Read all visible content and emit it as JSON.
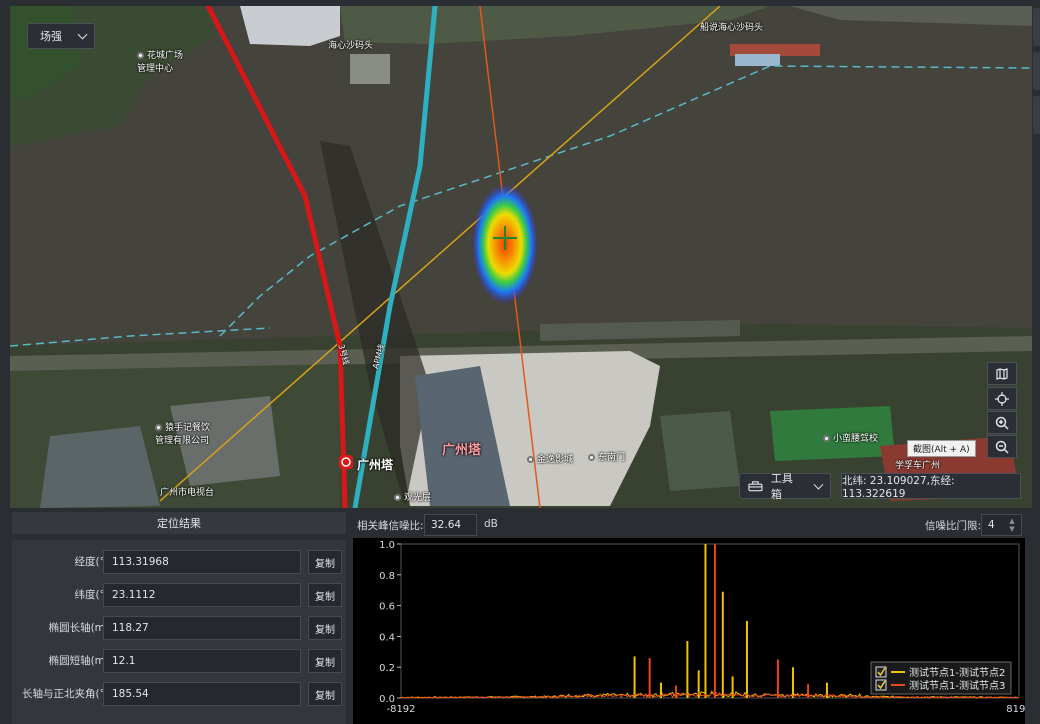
{
  "map": {
    "mode_label": "场强",
    "toolbox_label": "工具箱",
    "coordinates": "北纬: 23.109027,东经: 113.322619",
    "snapshot_tooltip": "截图(Alt + A)",
    "labels": [
      {
        "text": "花城广场\n管理中心",
        "kind": "poi"
      },
      {
        "text": "海心沙码头",
        "kind": "poi"
      },
      {
        "text": "船说海心沙码头",
        "kind": "poi"
      },
      {
        "text": "猿手记餐饮\n管理有限公司",
        "kind": "poi"
      },
      {
        "text": "广州市电视台",
        "kind": "poi"
      },
      {
        "text": "广州塔",
        "kind": "metro"
      },
      {
        "text": "广州塔",
        "kind": "landmark"
      },
      {
        "text": "金逸影城",
        "kind": "poi"
      },
      {
        "text": "东南门",
        "kind": "poi"
      },
      {
        "text": "观光层",
        "kind": "poi"
      },
      {
        "text": "小蛮腰驾校",
        "kind": "poi"
      },
      {
        "text": "学孚车广州",
        "kind": "poi"
      },
      {
        "text": "3号线",
        "kind": "line"
      },
      {
        "text": "APM线",
        "kind": "line"
      }
    ],
    "controls": [
      "map-layers-icon",
      "locate-icon",
      "zoom-in-icon",
      "zoom-out-icon"
    ]
  },
  "results": {
    "title": "定位结果",
    "copy_label": "复制",
    "rows": [
      {
        "label": "经度(°)",
        "value": "113.31968"
      },
      {
        "label": "纬度(°)",
        "value": "23.1112"
      },
      {
        "label": "椭圆长轴(m)",
        "value": "118.27"
      },
      {
        "label": "椭圆短轴(m)",
        "value": "12.1"
      },
      {
        "label": "长轴与正北夹角(°)",
        "value": "185.54"
      }
    ]
  },
  "spectrum": {
    "snr_label": "相关峰信噪比:",
    "snr_value": "32.64",
    "snr_unit": "dB",
    "threshold_label": "信噪比门限:",
    "threshold_value": "4"
  },
  "chart_data": {
    "type": "line",
    "xlim": [
      -8192,
      8192
    ],
    "ylim": [
      0.0,
      1.0
    ],
    "x_ticks": [
      "-8192",
      "8192"
    ],
    "y_ticks": [
      "0.0",
      "0.2",
      "0.4",
      "0.6",
      "0.8",
      "1.0"
    ],
    "legend_position": "bottom-right",
    "series": [
      {
        "name": "测试节点1-测试节点2",
        "color": "#f2c200",
        "noise_level": 0.02,
        "peaks": [
          {
            "x": -120,
            "y": 1.0
          },
          {
            "x": 340,
            "y": 0.69
          },
          {
            "x": 980,
            "y": 0.5
          },
          {
            "x": -600,
            "y": 0.37
          },
          {
            "x": -2000,
            "y": 0.27
          },
          {
            "x": -300,
            "y": 0.18
          },
          {
            "x": 2200,
            "y": 0.2
          },
          {
            "x": 600,
            "y": 0.14
          },
          {
            "x": -1300,
            "y": 0.1
          },
          {
            "x": 3100,
            "y": 0.1
          }
        ]
      },
      {
        "name": "测试节点1-测试节点3",
        "color": "#e8481a",
        "noise_level": 0.015,
        "peaks": [
          {
            "x": 130,
            "y": 1.0
          },
          {
            "x": -1600,
            "y": 0.26
          },
          {
            "x": 1800,
            "y": 0.25
          },
          {
            "x": -900,
            "y": 0.08
          },
          {
            "x": 2600,
            "y": 0.09
          }
        ]
      }
    ]
  }
}
